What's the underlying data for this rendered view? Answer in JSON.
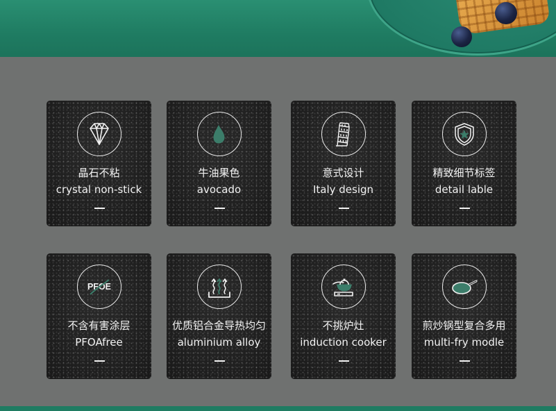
{
  "colors": {
    "accent_green": "#2a8f72",
    "panel_gray": "#6f7170",
    "card_dark": "#1e1e1e",
    "icon_fill_green": "#3c7d6a"
  },
  "features": [
    {
      "zh": "晶石不粘",
      "en": "crystal non-stick",
      "icon": "diamond-icon"
    },
    {
      "zh": "牛油果色",
      "en": "avocado",
      "icon": "droplet-icon"
    },
    {
      "zh": "意式设计",
      "en": "Italy design",
      "icon": "leaning-tower-icon"
    },
    {
      "zh": "精致细节标签",
      "en": "detail  lable",
      "icon": "star-shield-icon"
    },
    {
      "zh": "不含有害涂层",
      "en": "PFOAfree",
      "icon": "pfoe-icon",
      "icon_text": "PFOE"
    },
    {
      "zh": "优质铝合金导热均匀",
      "en": "aluminium alloy",
      "icon": "heat-waves-icon"
    },
    {
      "zh": "不挑炉灶",
      "en": "induction cooker",
      "icon": "pan-on-cooktop-icon"
    },
    {
      "zh": "煎炒锅型复合多用",
      "en": "multi-fry modle",
      "icon": "frying-pan-icon"
    }
  ]
}
